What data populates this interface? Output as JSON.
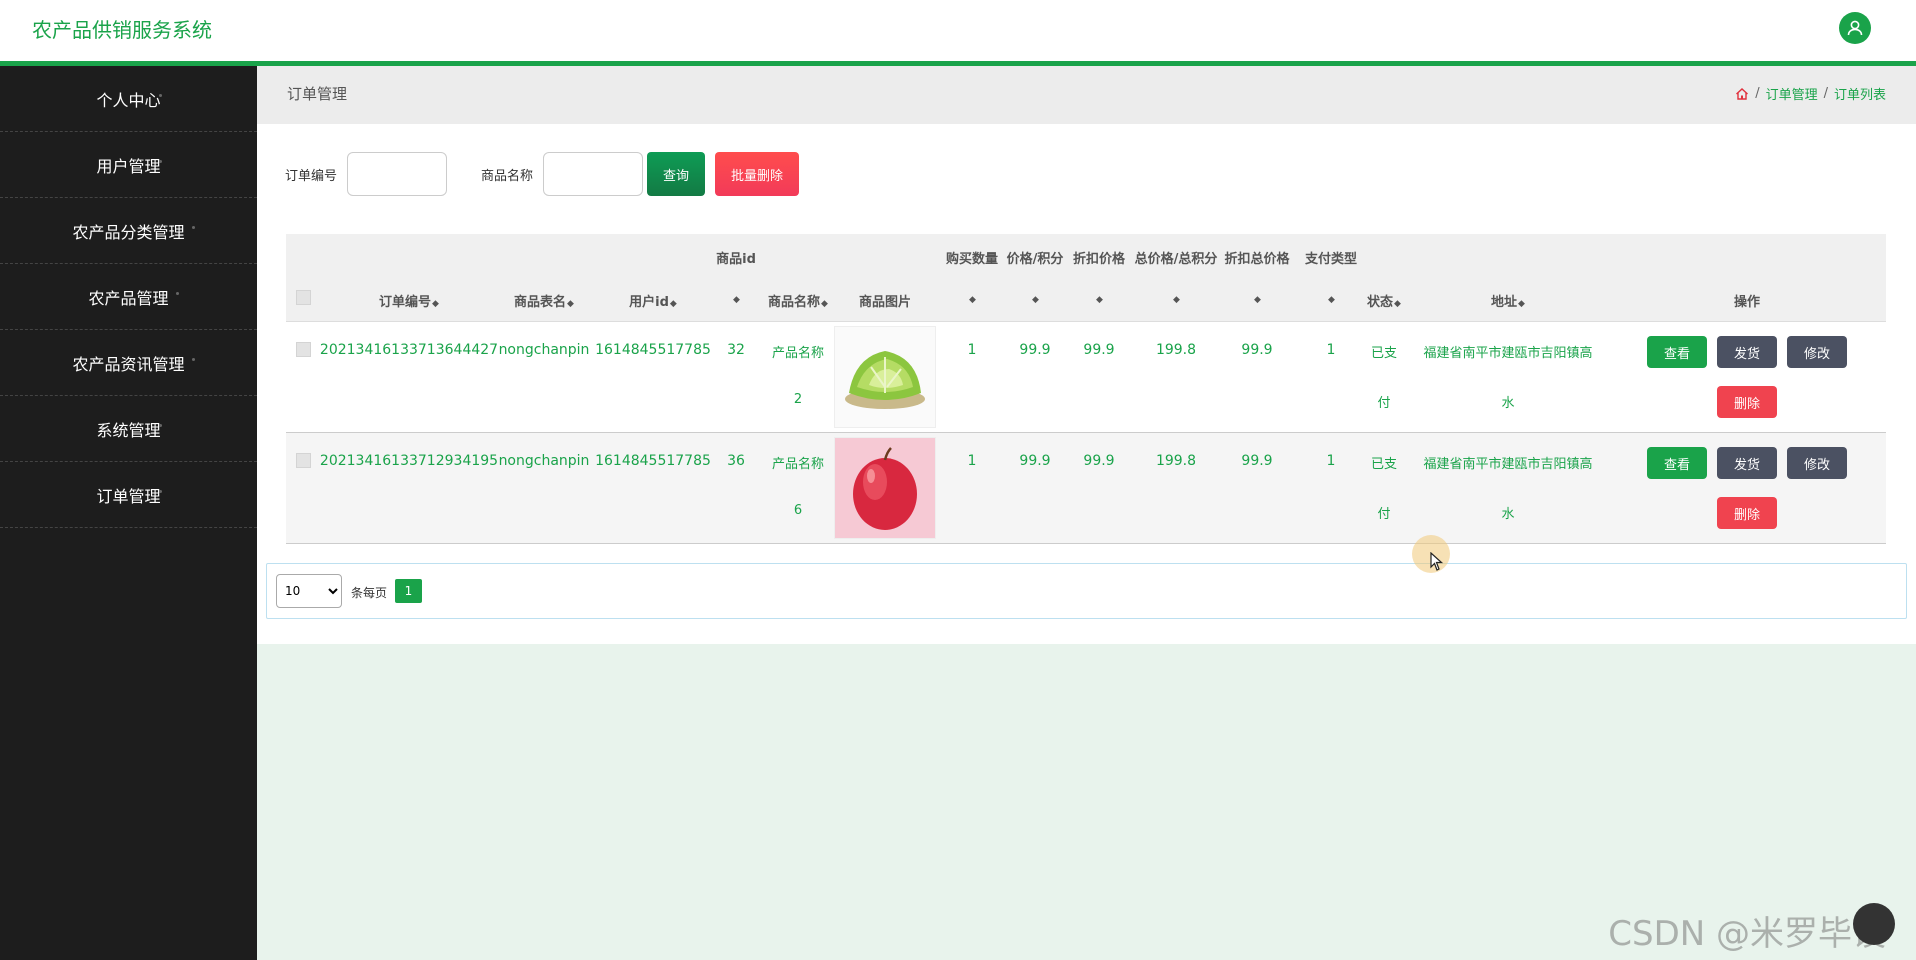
{
  "header": {
    "title": "农产品供销服务系统",
    "avatar_icon": "user-icon"
  },
  "sidebar": {
    "items": [
      {
        "label": "个人中心"
      },
      {
        "label": "用户管理"
      },
      {
        "label": "农产品分类管理"
      },
      {
        "label": "农产品管理"
      },
      {
        "label": "农产品资讯管理"
      },
      {
        "label": "系统管理"
      },
      {
        "label": "订单管理"
      }
    ]
  },
  "page": {
    "title": "订单管理",
    "breadcrumb": [
      "订单管理",
      "订单列表"
    ],
    "breadcrumb_sep": "/"
  },
  "search": {
    "order_no_label": "订单编号",
    "order_no_value": "",
    "product_name_label": "商品名称",
    "product_name_value": "",
    "query_label": "查询",
    "bulk_delete_label": "批量删除"
  },
  "table": {
    "group_headers": {
      "product_id": "商品id",
      "qty": "购买数量",
      "price": "价格/积分",
      "discount": "折扣价格",
      "total": "总价格/总积分",
      "discount_total": "折扣总价格",
      "pay_type": "支付类型"
    },
    "headers": {
      "order_no": "订单编号",
      "table_name": "商品表名",
      "user_id": "用户id",
      "product_name": "商品名称",
      "product_image": "商品图片",
      "status": "状态",
      "address": "地址",
      "actions": "操作"
    },
    "sort_icon": "sort-icon",
    "rows": [
      {
        "order_no": "20213416133713644427",
        "table_name": "nongchanpin",
        "user_id": "1614845517785",
        "product_id": "32",
        "product_name_1": "产品名称",
        "product_name_2": "2",
        "image": "lettuce",
        "qty": "1",
        "price": "99.9",
        "discount": "99.9",
        "total": "199.8",
        "discount_total": "99.9",
        "pay_type": "1",
        "status_1": "已支",
        "status_2": "付",
        "address_1": "福建省南平市建瓯市吉阳镇高",
        "address_2": "水"
      },
      {
        "order_no": "20213416133712934195",
        "table_name": "nongchanpin",
        "user_id": "1614845517785",
        "product_id": "36",
        "product_name_1": "产品名称",
        "product_name_2": "6",
        "image": "apple",
        "qty": "1",
        "price": "99.9",
        "discount": "99.9",
        "total": "199.8",
        "discount_total": "99.9",
        "pay_type": "1",
        "status_1": "已支",
        "status_2": "付",
        "address_1": "福建省南平市建瓯市吉阳镇高",
        "address_2": "水"
      }
    ],
    "actions": {
      "view": "查看",
      "ship": "发货",
      "edit": "修改",
      "delete": "删除"
    }
  },
  "pagination": {
    "page_size": "10",
    "per_page_label": "条每页",
    "current_page": "1"
  },
  "watermark": "CSDN @米罗毕设",
  "colors": {
    "accent": "#1aa34a",
    "sidebar_bg": "#1d1d1d",
    "danger": "#f0434f",
    "dark_button": "#4b5162"
  }
}
